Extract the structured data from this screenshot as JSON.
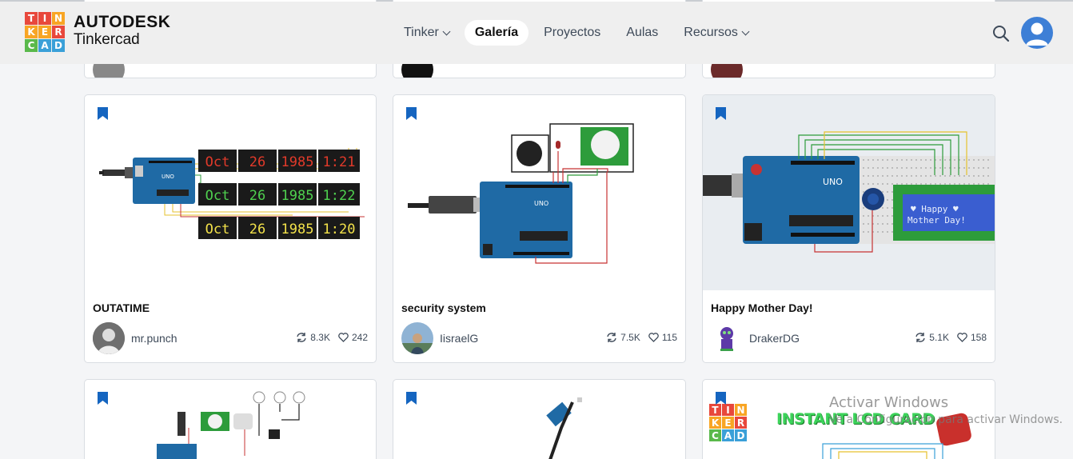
{
  "header": {
    "logo_letters": [
      "T",
      "I",
      "N",
      "K",
      "E",
      "R",
      "C",
      "A",
      "D"
    ],
    "logo_colors": [
      "#e8483c",
      "#e8483c",
      "#f8a524",
      "#f8a524",
      "#f8a524",
      "#e8483c",
      "#5ab94b",
      "#3aa0d8",
      "#3aa0d8"
    ],
    "brand_line1": "AUTODESK",
    "brand_line2": "Tinkercad",
    "nav": [
      {
        "label": "Tinker",
        "has_caret": true,
        "active": false
      },
      {
        "label": "Galería",
        "has_caret": false,
        "active": true
      },
      {
        "label": "Proyectos",
        "has_caret": false,
        "active": false
      },
      {
        "label": "Aulas",
        "has_caret": false,
        "active": false
      },
      {
        "label": "Recursos",
        "has_caret": true,
        "active": false
      }
    ],
    "search_icon": "search-icon",
    "avatar_icon": "user-avatar-icon"
  },
  "cards": [
    {
      "title": "OUTATIME",
      "user": "mr.punch",
      "remixes": "8.3K",
      "likes": "242"
    },
    {
      "title": "security system",
      "user": "IisraelG",
      "remixes": "7.5K",
      "likes": "115"
    },
    {
      "title": "Happy Mother Day!",
      "user": "DrakerDG",
      "remixes": "5.1K",
      "likes": "158"
    }
  ],
  "lcd_text": {
    "line1": "♥ Happy ♥",
    "line2": "Mother Day!"
  },
  "displays": {
    "row_red": [
      "Oct",
      "26",
      "1985",
      "1:21"
    ],
    "row_green": [
      "Oct",
      "26",
      "1985",
      "1:22"
    ],
    "row_yellow": [
      "Oct",
      "26",
      "1985",
      "1:20"
    ]
  },
  "bottom_card3_banner": "INSTANT LCD CARD",
  "bottom_card3_logo": [
    "T",
    "I",
    "N",
    "K",
    "E",
    "R",
    "C",
    "A",
    "D"
  ],
  "watermark": {
    "line1": "Activar Windows",
    "line2": "Ve a Configuración para activar Windows."
  }
}
